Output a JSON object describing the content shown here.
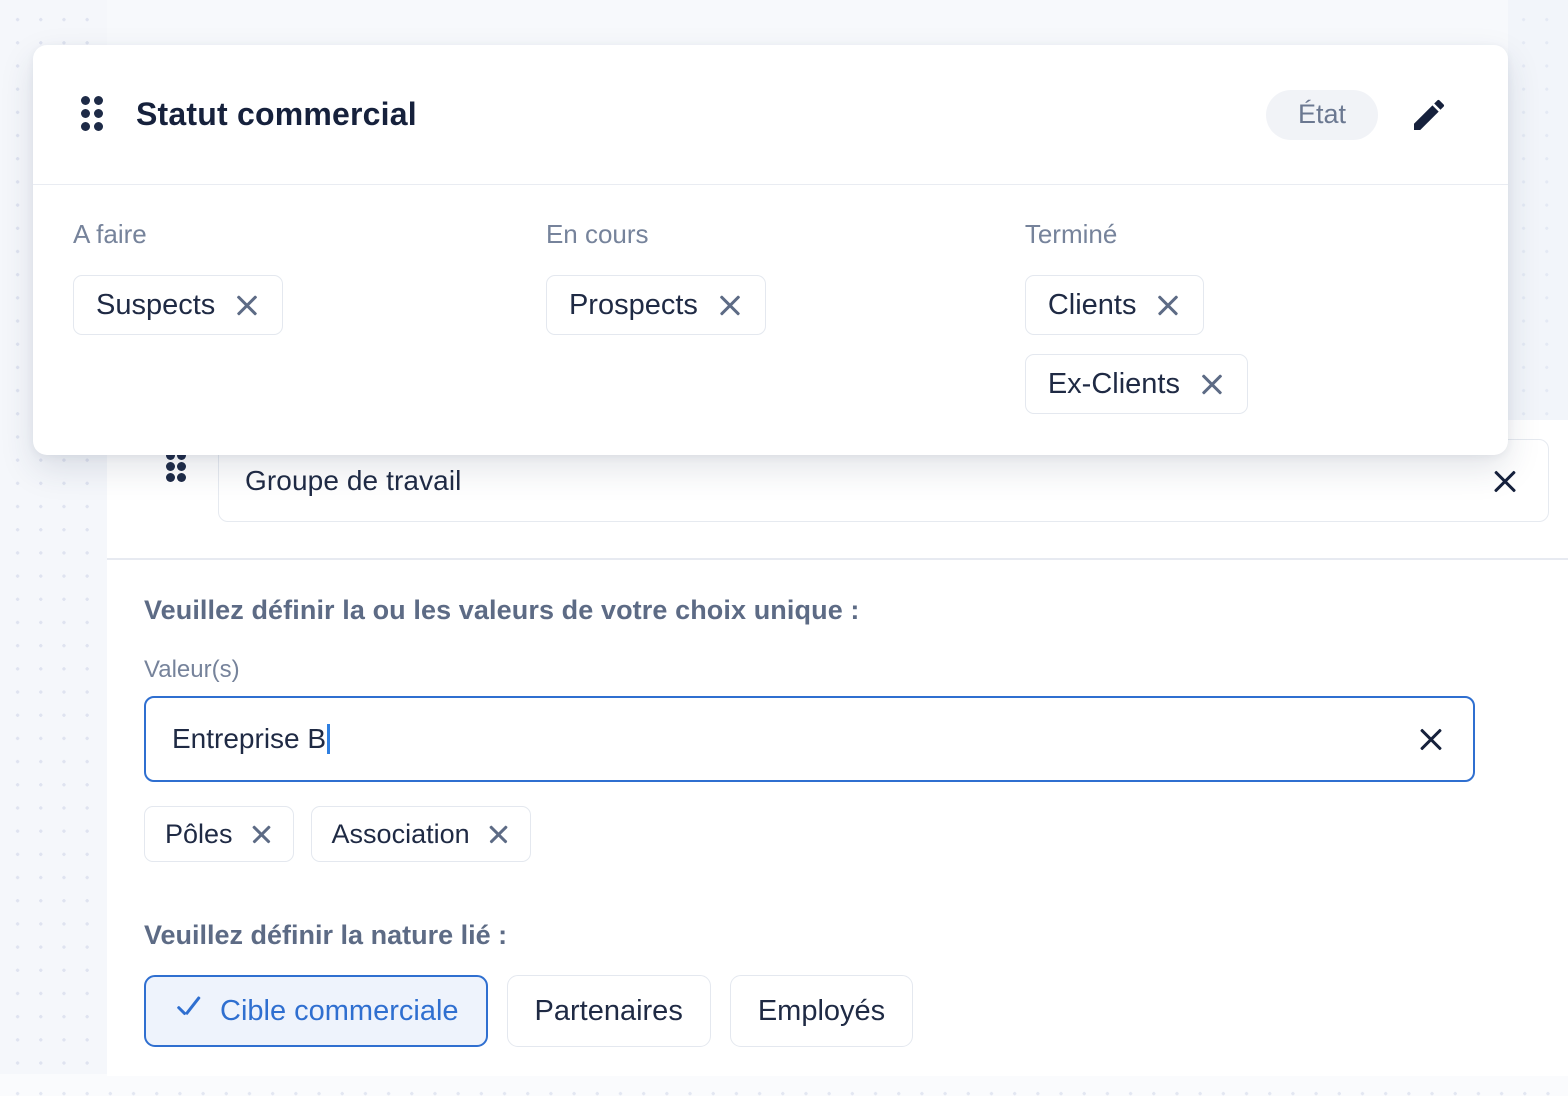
{
  "card": {
    "drag_handle_icon": "drag-handle-icon",
    "title": "Statut commercial",
    "state_badge": "État",
    "edit_icon": "pencil-edit-icon",
    "columns": [
      {
        "header": "A faire",
        "chips": [
          {
            "label": "Suspects",
            "remove_icon": "close-icon"
          }
        ]
      },
      {
        "header": "En cours",
        "chips": [
          {
            "label": "Prospects",
            "remove_icon": "close-icon"
          }
        ]
      },
      {
        "header": "Terminé",
        "chips": [
          {
            "label": "Clients",
            "remove_icon": "close-icon"
          },
          {
            "label": "Ex-Clients",
            "remove_icon": "close-icon"
          }
        ]
      }
    ]
  },
  "group_row": {
    "drag_handle_icon": "drag-handle-icon",
    "label": "Groupe de travail",
    "clear_icon": "close-icon"
  },
  "values_section": {
    "title": "Veuillez définir la ou les valeurs de votre choix unique :",
    "field_label": "Valeur(s)",
    "input_value": "Entreprise B",
    "input_focused": true,
    "clear_icon": "close-icon",
    "chips": [
      {
        "label": "Pôles",
        "remove_icon": "close-icon"
      },
      {
        "label": "Association",
        "remove_icon": "close-icon"
      }
    ]
  },
  "nature_section": {
    "title": "Veuillez définir la nature lié :",
    "options": [
      {
        "label": "Cible commerciale",
        "selected": true,
        "check_icon": "check-icon"
      },
      {
        "label": "Partenaires",
        "selected": false
      },
      {
        "label": "Employés",
        "selected": false
      }
    ]
  },
  "colors": {
    "accent": "#2f6fd0",
    "accent_soft_bg": "#eef3fc",
    "text_dark": "#1f2a44",
    "text_muted": "#76839b",
    "heading_muted": "#5d6b85",
    "border": "#e4e8ef",
    "badge_bg": "#f1f3f7",
    "panel_bg": "#f7f9fc"
  }
}
